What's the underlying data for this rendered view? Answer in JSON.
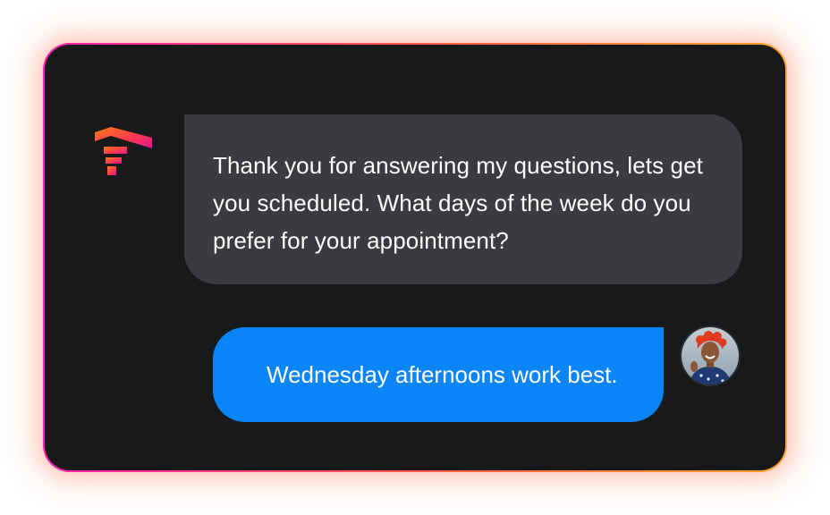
{
  "colors": {
    "card_bg": "#18191b",
    "bot_bubble_bg": "#393b3f",
    "user_bubble_bg": "#0a85f7",
    "border_gradient": [
      "#ff1fb2",
      "#ff5a4a",
      "#ffa52a"
    ]
  },
  "bot": {
    "logo_icon": "brand-logo-icon",
    "message": "Thank you for answering my questions, lets get you scheduled. What days of the week do you prefer for your appointment?"
  },
  "user": {
    "avatar_icon": "user-avatar",
    "message": "Wednesday afternoons work best."
  }
}
